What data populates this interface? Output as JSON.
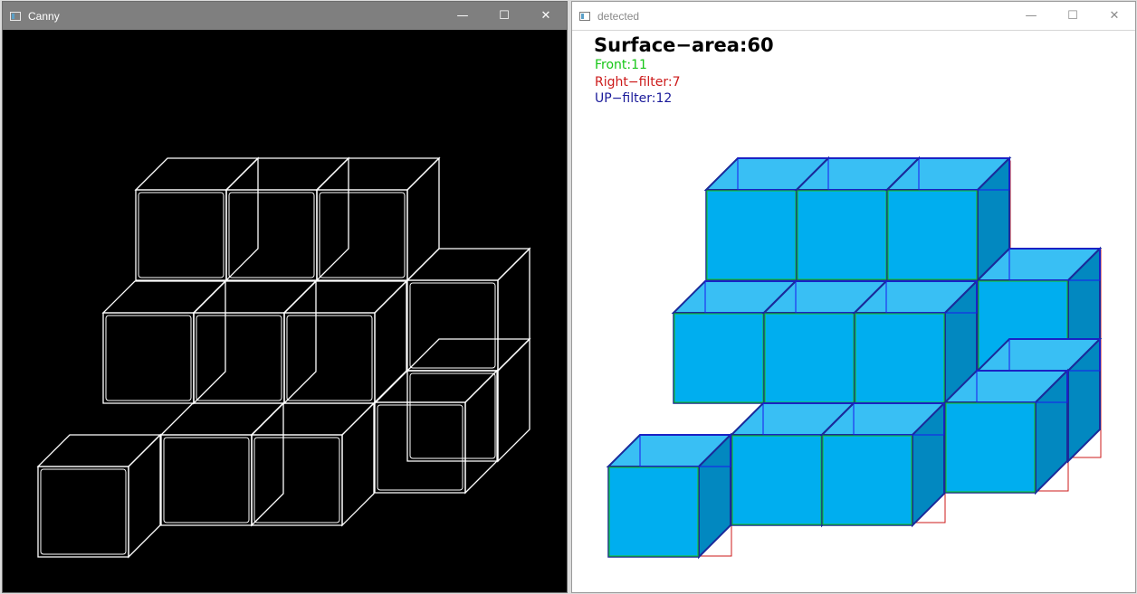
{
  "canny_window": {
    "title": "Canny",
    "minimize_glyph": "—",
    "maximize_glyph": "☐",
    "close_glyph": "✕"
  },
  "detected_window": {
    "title": "detected",
    "minimize_glyph": "—",
    "maximize_glyph": "☐",
    "close_glyph": "✕",
    "surface_area_label": "Surface−area:60",
    "front_label": "Front:11",
    "right_filter_label": "Right−filter:7",
    "up_filter_label": "UP−filter:12"
  },
  "colors": {
    "canny_background": "#000000",
    "edge_lines": "#ffffff",
    "front_face": "#00aeef",
    "top_face": "#39bff4",
    "side_face": "#0288c0",
    "cube_outline": "#1a2a9a",
    "front_box": "#16c616",
    "right_box": "#cc1a1a",
    "up_box": "#1a1aee"
  }
}
